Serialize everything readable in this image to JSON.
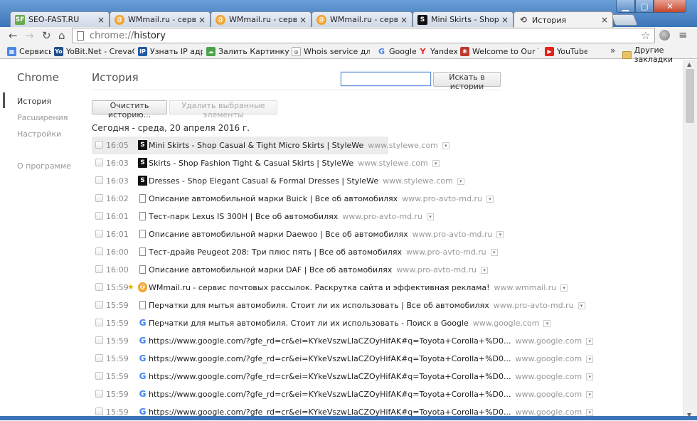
{
  "tabs": [
    {
      "label": "SEO-FAST.RU",
      "icon": "sf-favicon",
      "color": "#6aa84f"
    },
    {
      "label": "WMmail.ru - сервис по",
      "icon": "wmmail-favicon",
      "color": "#f3a32a"
    },
    {
      "label": "WMmail.ru - сервис по",
      "icon": "wmmail-favicon",
      "color": "#f3a32a"
    },
    {
      "label": "WMmail.ru - сервис по",
      "icon": "wmmail-favicon",
      "color": "#f3a32a"
    },
    {
      "label": "Mini Skirts - Shop Casu",
      "icon": "stylewe-favicon",
      "color": "#111111"
    },
    {
      "label": "История",
      "icon": "history-icon",
      "color": "#555555"
    }
  ],
  "omnibox": {
    "scheme": "chrome://",
    "path": "history"
  },
  "bookmarks": [
    {
      "label": "Сервисы",
      "icon": "apps-icon",
      "color": "#4a86e8"
    },
    {
      "label": "YoBit.Net - CrevaCoin",
      "icon": "yobit-favicon",
      "color": "#1f4e8c"
    },
    {
      "label": "Узнать IP адрес",
      "icon": "ip-favicon",
      "color": "#1f5ba8"
    },
    {
      "label": "Залить Картинку - За",
      "icon": "image-upload-favicon",
      "color": "#4aa34a"
    },
    {
      "label": "Whois service для пр",
      "icon": "whois-favicon",
      "color": "#666666"
    },
    {
      "label": "Google",
      "icon": "google-favicon",
      "color": "#4285f4"
    },
    {
      "label": "Yandex",
      "icon": "yandex-favicon",
      "color": "#e52620"
    },
    {
      "label": "Welcome to Our Team",
      "icon": "team-favicon",
      "color": "#c0392b"
    },
    {
      "label": "YouTube",
      "icon": "youtube-favicon",
      "color": "#e62117"
    }
  ],
  "bookmarks_more": "»",
  "other_bookmarks": "Другие закладки",
  "sidebar": {
    "brand": "Chrome",
    "items": [
      {
        "label": "История",
        "active": true
      },
      {
        "label": "Расширения",
        "active": false
      },
      {
        "label": "Настройки",
        "active": false
      },
      {
        "label": "О программе",
        "active": false
      }
    ]
  },
  "main": {
    "title": "История",
    "search_placeholder": "",
    "search_button": "Искать в истории",
    "clear_button": "Очистить историю...",
    "remove_button": "Удалить выбранные элементы",
    "day_heading": "Сегодня - среда, 20 апреля 2016 г."
  },
  "entries": [
    {
      "time": "16:05",
      "title": "Mini Skirts - Shop Casual & Tight Micro Skirts | StyleWe",
      "domain": "www.stylewe.com",
      "icon": "stylewe",
      "starred": false
    },
    {
      "time": "16:03",
      "title": "Skirts - Shop Fashion Tight & Casual Skirts | StyleWe",
      "domain": "www.stylewe.com",
      "icon": "stylewe",
      "starred": false
    },
    {
      "time": "16:03",
      "title": "Dresses - Shop Elegant Casual & Formal Dresses | StyleWe",
      "domain": "www.stylewe.com",
      "icon": "stylewe",
      "starred": false
    },
    {
      "time": "16:02",
      "title": "Описание автомобильной марки Buick | Все об автомобилях",
      "domain": "www.pro-avto-md.ru",
      "icon": "page",
      "starred": false
    },
    {
      "time": "16:01",
      "title": "Тест-парк Lexus IS 300H | Все об автомобилях",
      "domain": "www.pro-avto-md.ru",
      "icon": "page",
      "starred": false
    },
    {
      "time": "16:01",
      "title": "Описание автомобильной марки Daewoo | Все об автомобилях",
      "domain": "www.pro-avto-md.ru",
      "icon": "page",
      "starred": false
    },
    {
      "time": "16:00",
      "title": "Тест-драйв Peugeot 208: Три плюс пять | Все об автомобилях",
      "domain": "www.pro-avto-md.ru",
      "icon": "page",
      "starred": false
    },
    {
      "time": "16:00",
      "title": "Описание автомобильной марки DAF | Все об автомобилях",
      "domain": "www.pro-avto-md.ru",
      "icon": "page",
      "starred": false
    },
    {
      "time": "15:59",
      "title": "WMmail.ru - сервис почтовых рассылок. Раскрутка сайта и эффективная реклама!",
      "domain": "www.wmmail.ru",
      "icon": "wmmail",
      "starred": true
    },
    {
      "time": "15:59",
      "title": "Перчатки для мытья автомобиля. Стоит ли их использовать | Все об автомобилях",
      "domain": "www.pro-avto-md.ru",
      "icon": "page",
      "starred": false
    },
    {
      "time": "15:59",
      "title": "Перчатки для мытья автомобиля. Стоит ли их использовать - Поиск в Google",
      "domain": "www.google.com",
      "icon": "google",
      "starred": false
    },
    {
      "time": "15:59",
      "title": "https://www.google.com/?gfe_rd=cr&ei=KYkeVszwLlaCZOyHifAK#q=Toyota+Corolla+%D0...",
      "domain": "www.google.com",
      "icon": "google",
      "starred": false
    },
    {
      "time": "15:59",
      "title": "https://www.google.com/?gfe_rd=cr&ei=KYkeVszwLlaCZOyHifAK#q=Toyota+Corolla+%D0...",
      "domain": "www.google.com",
      "icon": "google",
      "starred": false
    },
    {
      "time": "15:59",
      "title": "https://www.google.com/?gfe_rd=cr&ei=KYkeVszwLlaCZOyHifAK#q=Toyota+Corolla+%D0...",
      "domain": "www.google.com",
      "icon": "google",
      "starred": false
    },
    {
      "time": "15:59",
      "title": "https://www.google.com/?gfe_rd=cr&ei=KYkeVszwLlaCZOyHifAK#q=Toyota+Corolla+%D0...",
      "domain": "www.google.com",
      "icon": "google",
      "starred": false
    },
    {
      "time": "15:59",
      "title": "https://www.google.com/?gfe_rd=cr&ei=KYkeVszwLlaCZOyHifAK#q=Toyota+Corolla+%D0...",
      "domain": "www.google.com",
      "icon": "google",
      "starred": false
    }
  ]
}
